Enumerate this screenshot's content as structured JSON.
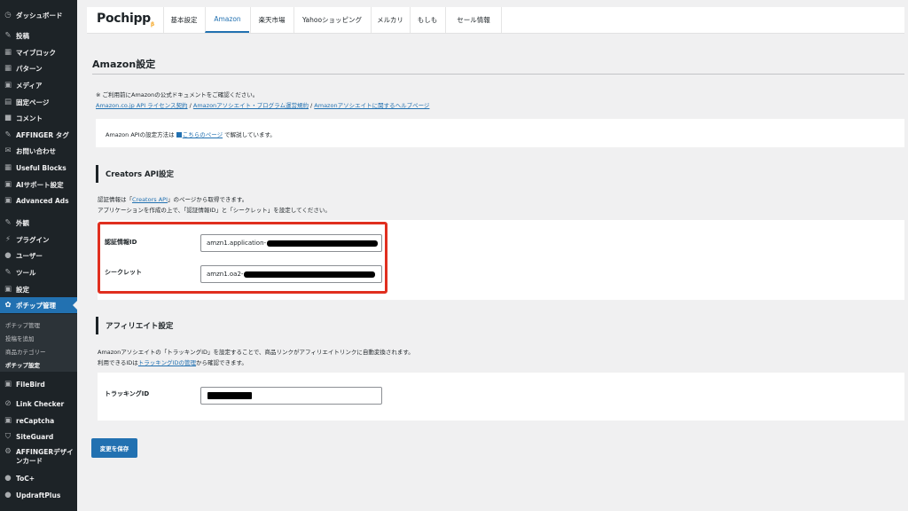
{
  "sidebar": {
    "items": [
      {
        "label": "ダッシュボード",
        "icon": "dashboard-icon",
        "glyph": "◷"
      },
      {
        "label": "投稿",
        "icon": "pin-icon",
        "glyph": "✎"
      },
      {
        "label": "マイブロック",
        "icon": "blocks-icon",
        "glyph": "▦"
      },
      {
        "label": "パターン",
        "icon": "patterns-icon",
        "glyph": "▦"
      },
      {
        "label": "メディア",
        "icon": "media-icon",
        "glyph": "▣"
      },
      {
        "label": "固定ページ",
        "icon": "page-icon",
        "glyph": "▤"
      },
      {
        "label": "コメント",
        "icon": "comment-icon",
        "glyph": "■"
      },
      {
        "label": "AFFINGER タグ",
        "icon": "pin-icon",
        "glyph": "✎"
      },
      {
        "label": "お問い合わせ",
        "icon": "mail-icon",
        "glyph": "✉"
      },
      {
        "label": "Useful Blocks",
        "icon": "blocks-icon",
        "glyph": "▦"
      },
      {
        "label": "AIサポート設定",
        "icon": "ai-icon",
        "glyph": "▣"
      },
      {
        "label": "Advanced Ads",
        "icon": "ads-icon",
        "glyph": "▣"
      },
      {
        "label": "外観",
        "icon": "appearance-icon",
        "glyph": "✎"
      },
      {
        "label": "プラグイン",
        "icon": "plugin-icon",
        "glyph": "⚡"
      },
      {
        "label": "ユーザー",
        "icon": "user-icon",
        "glyph": "●"
      },
      {
        "label": "ツール",
        "icon": "tool-icon",
        "glyph": "✎"
      },
      {
        "label": "設定",
        "icon": "settings-icon",
        "glyph": "▣"
      },
      {
        "label": "ポチップ管理",
        "icon": "pochipp-icon",
        "glyph": "✿"
      },
      {
        "label": "FileBird",
        "icon": "folder-icon",
        "glyph": "▣"
      },
      {
        "label": "Link Checker",
        "icon": "link-icon",
        "glyph": "⊘"
      },
      {
        "label": "reCaptcha",
        "icon": "recaptcha-icon",
        "glyph": "▣"
      },
      {
        "label": "SiteGuard",
        "icon": "shield-icon",
        "glyph": "⛉"
      },
      {
        "label": "AFFINGERデザインカード",
        "icon": "gear-icon",
        "glyph": "⚙"
      },
      {
        "label": "ToC+",
        "icon": "toc-icon",
        "glyph": "●"
      },
      {
        "label": "UpdraftPlus",
        "icon": "backup-icon",
        "glyph": "●"
      }
    ],
    "submenu": [
      "ポチップ管理",
      "投稿を追加",
      "商品カテゴリー",
      "ポチップ設定"
    ]
  },
  "topnav": {
    "logo": "Pochipp",
    "logo_suffix": "β",
    "tabs": [
      "基本設定",
      "Amazon",
      "楽天市場",
      "Yahooショッピング",
      "メルカリ",
      "もしも",
      "セール情報"
    ],
    "active_tab": "Amazon"
  },
  "main": {
    "title": "Amazon設定",
    "notice": "※ ご利用前にAmazonの公式ドキュメントをご確認ください。",
    "doc_links": [
      "Amazon.co.jp API ライセンス契約",
      "Amazonアソシエイト・プログラム運営規約",
      "Amazonアソシエイトに関するヘルプページ"
    ],
    "link_separator": " / ",
    "api_note_prefix": "Amazon APIの設定方法は",
    "api_note_link": "こちらのページ",
    "api_note_suffix": "で解説しています。",
    "creators": {
      "heading": "Creators API設定",
      "desc1_prefix": "認証情報は「",
      "desc1_link": "Creators API",
      "desc1_suffix": "」のページから取得できます。",
      "desc2": "アプリケーションを作成の上で、「認証情報ID」と「シークレット」を設定してください。",
      "id_label": "認証情報ID",
      "id_value": "amzn1.application-",
      "secret_label": "シークレット",
      "secret_value": "amzn1.oa2-"
    },
    "affiliate": {
      "heading": "アフィリエイト設定",
      "desc1": "Amazonアソシエイトの「トラッキングID」を設定することで、商品リンクがアフィリエイトリンクに自動変換されます。",
      "desc2_prefix": "利用できるIDは",
      "desc2_link": "トラッキングIDの管理",
      "desc2_suffix": "から確認できます。",
      "tracking_label": "トラッキングID",
      "tracking_value": ""
    },
    "save_button": "変更を保存"
  },
  "colors": {
    "sidebar_bg": "#1d2327",
    "accent": "#2271b1",
    "highlight": "#e02f1f"
  }
}
